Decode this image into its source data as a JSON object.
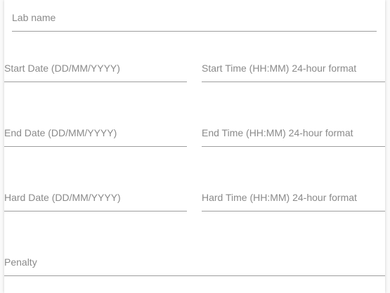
{
  "form": {
    "lab_name": {
      "placeholder": "Lab name",
      "value": ""
    },
    "start_date": {
      "placeholder": "Start Date (DD/MM/YYYY)",
      "value": ""
    },
    "start_time": {
      "placeholder": "Start Time (HH:MM) 24-hour format",
      "value": ""
    },
    "end_date": {
      "placeholder": "End Date (DD/MM/YYYY)",
      "value": ""
    },
    "end_time": {
      "placeholder": "End Time (HH:MM) 24-hour format",
      "value": ""
    },
    "hard_date": {
      "placeholder": "Hard Date (DD/MM/YYYY)",
      "value": ""
    },
    "hard_time": {
      "placeholder": "Hard Time (HH:MM) 24-hour format",
      "value": ""
    },
    "penalty": {
      "placeholder": "Penalty",
      "value": ""
    }
  },
  "colors": {
    "underline": "#9e9e9e",
    "placeholder": "#8a8a8a",
    "background": "#ffffff"
  }
}
